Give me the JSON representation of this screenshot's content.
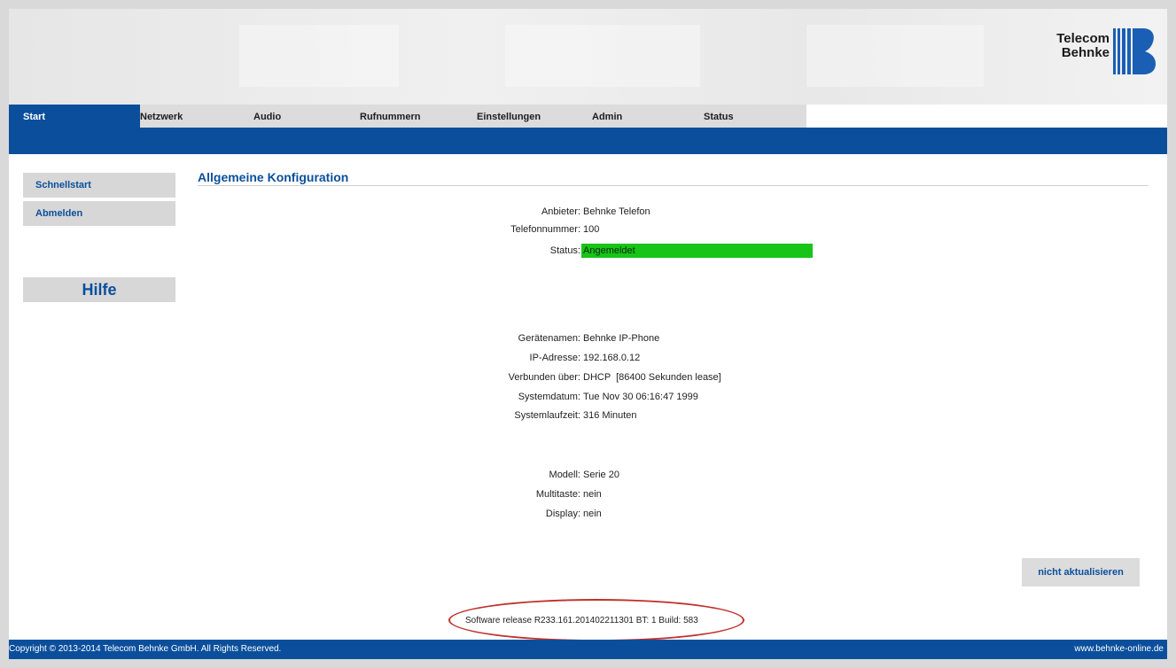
{
  "brand": {
    "logo_text": "Telecom\nBehnke",
    "logo_color": "#1a5fb4"
  },
  "nav": {
    "tabs": [
      {
        "label": "Start",
        "active": true
      },
      {
        "label": "Netzwerk",
        "active": false
      },
      {
        "label": "Audio",
        "active": false
      },
      {
        "label": "Rufnummern",
        "active": false
      },
      {
        "label": "Einstellungen",
        "active": false
      },
      {
        "label": "Admin",
        "active": false
      },
      {
        "label": "Status",
        "active": false
      }
    ]
  },
  "sidebar": {
    "items": [
      {
        "label": "Schnellstart"
      },
      {
        "label": "Abmelden"
      }
    ],
    "help_label": "Hilfe"
  },
  "main": {
    "title": "Allgemeine Konfiguration",
    "account": [
      {
        "label": "Anbieter:",
        "value": "Behnke Telefon"
      },
      {
        "label": "Telefonnummer:",
        "value": "100"
      },
      {
        "label": "Status:",
        "value": "Angemeldet"
      }
    ],
    "device": [
      {
        "label": "Gerätenamen:",
        "value": "Behnke IP-Phone"
      },
      {
        "label": "IP-Adresse:",
        "value": "192.168.0.12"
      },
      {
        "label": "Verbunden über:",
        "value": "DHCP  [86400 Sekunden lease]"
      },
      {
        "label": "Systemdatum:",
        "value": "Tue Nov 30 06:16:47 1999"
      },
      {
        "label": "Systemlaufzeit:",
        "value": "316 Minuten"
      }
    ],
    "model": [
      {
        "label": "Modell:",
        "value": "Serie 20"
      },
      {
        "label": "Multitaste:",
        "value": "nein"
      },
      {
        "label": "Display:",
        "value": "nein"
      }
    ],
    "refresh_label": "nicht aktualisieren",
    "software_release": "Software release R233.161.201402211301 BT: 1 Build: 583"
  },
  "footer": {
    "copyright": "Copyright © 2013-2014 Telecom Behnke GmbH. All Rights Reserved.",
    "website": "www.behnke-online.de"
  },
  "colors": {
    "primary_blue": "#0b4f9c",
    "status_ok": "#18c418",
    "highlight_oval": "#c0302c"
  }
}
